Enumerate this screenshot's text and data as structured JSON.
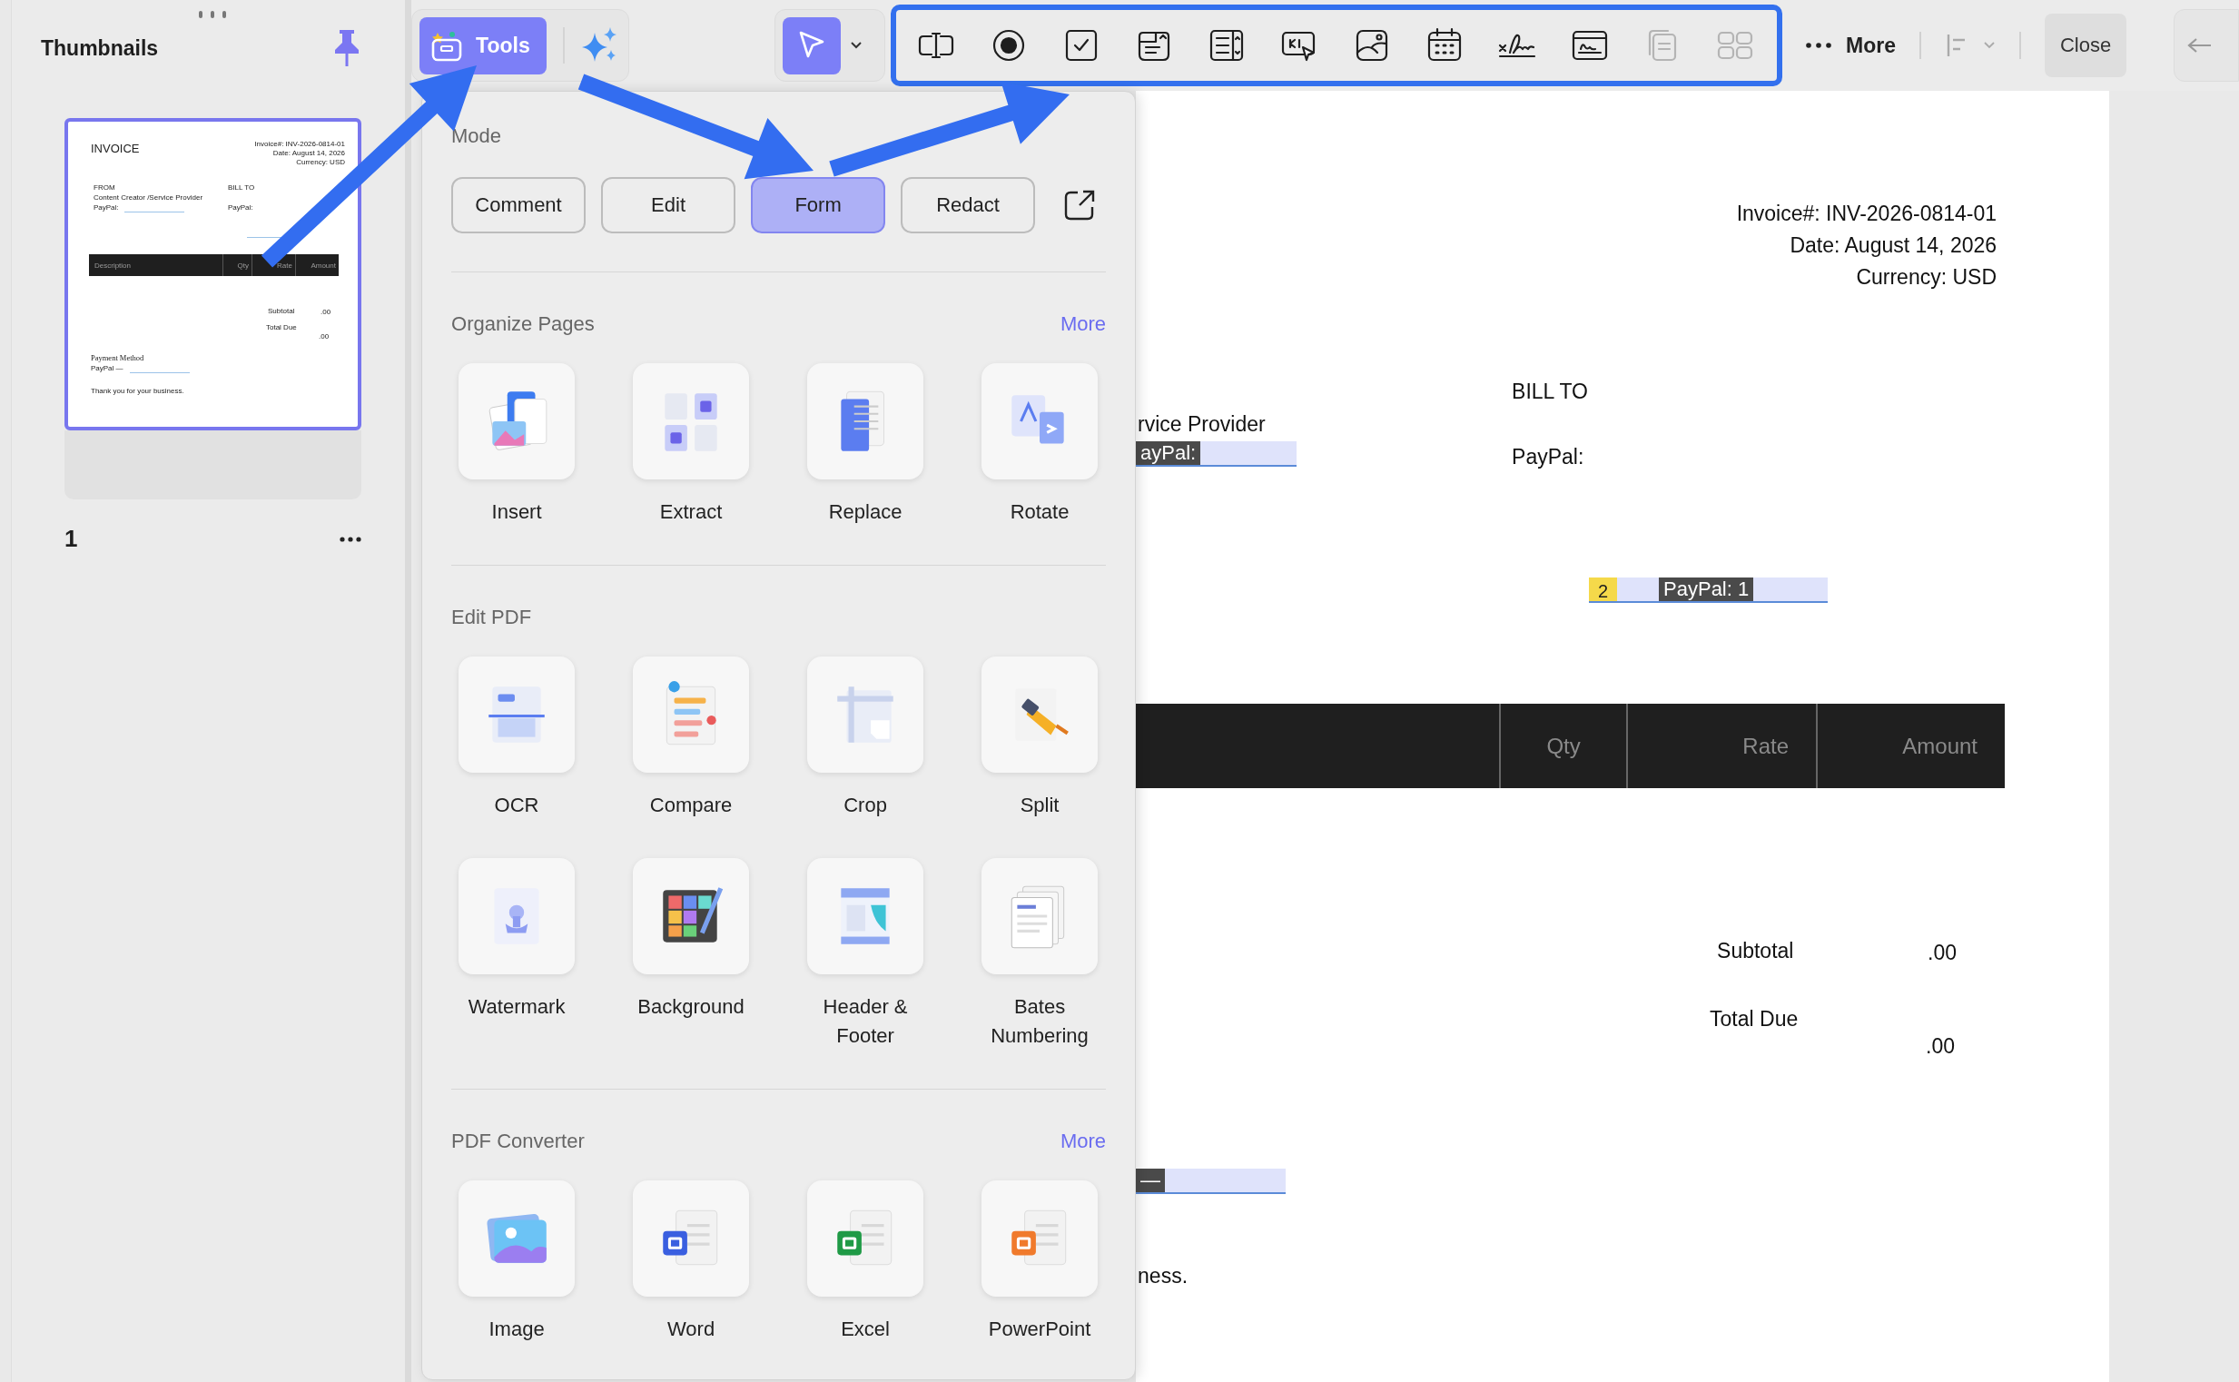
{
  "sidebar": {
    "title": "Thumbnails",
    "pages": [
      {
        "number": "1",
        "selected": true
      }
    ]
  },
  "thumbnail": {
    "title": "INVOICE",
    "meta": [
      "Invoice#: INV-2026-0814-01",
      "Date: August 14, 2026",
      "Currency: USD"
    ],
    "from_label": "FROM",
    "from_name": "Content Creator /Service Provider",
    "from_paypal": "PayPal:",
    "bill_to": "BILL TO",
    "bill_to_paypal": "PayPal:",
    "table_columns": [
      "Description",
      "Qty",
      "Rate",
      "Amount"
    ],
    "subtotal_label": "Subtotal",
    "subtotal_value": ".00",
    "total_label": "Total Due",
    "total_value": ".00",
    "payment_title": "Payment Method",
    "payment_line": "PayPal —",
    "thanks": "Thank you for your business."
  },
  "toolbar": {
    "tools": {
      "label": "Tools",
      "selected": true
    },
    "pointer": {
      "selected": true
    },
    "form_tools": [
      {
        "disabled": false
      },
      {
        "disabled": false
      },
      {
        "disabled": false
      },
      {
        "disabled": false
      },
      {
        "disabled": false
      },
      {
        "disabled": false
      },
      {
        "disabled": false
      },
      {
        "disabled": false
      },
      {
        "disabled": false
      },
      {
        "disabled": false
      },
      {
        "disabled": true
      },
      {
        "disabled": true
      }
    ],
    "more": "More",
    "close": "Close"
  },
  "tools_panel": {
    "mode_title": "Mode",
    "modes": [
      {
        "label": "Comment",
        "selected": false
      },
      {
        "label": "Edit",
        "selected": false
      },
      {
        "label": "Form",
        "selected": true
      },
      {
        "label": "Redact",
        "selected": false
      }
    ],
    "sections": [
      {
        "title": "Organize Pages",
        "more": "More",
        "items": [
          {
            "label": "Insert"
          },
          {
            "label": "Extract"
          },
          {
            "label": "Replace"
          },
          {
            "label": "Rotate"
          }
        ]
      },
      {
        "title": "Edit PDF",
        "items": [
          {
            "label": "OCR"
          },
          {
            "label": "Compare"
          },
          {
            "label": "Crop"
          },
          {
            "label": "Split"
          },
          {
            "label": "Watermark"
          },
          {
            "label": "Background"
          },
          {
            "label": "Header & Footer"
          },
          {
            "label": "Bates Numbering"
          }
        ]
      },
      {
        "title": "PDF Converter",
        "more": "More",
        "items": [
          {
            "label": "Image"
          },
          {
            "label": "Word"
          },
          {
            "label": "Excel"
          },
          {
            "label": "PowerPoint"
          }
        ]
      }
    ]
  },
  "document": {
    "header_lines": [
      "Invoice#: INV-2026-0814-01",
      "Date: August 14, 2026",
      "Currency: USD"
    ],
    "bill_to": "BILL TO",
    "bill_to_paypal": "PayPal:",
    "provider_text": "rvice Provider",
    "fields": [
      {
        "label": "ayPal:"
      },
      {
        "badge": "2",
        "label": "PayPal: 1"
      },
      {
        "label": "—"
      }
    ],
    "table_columns": [
      "Qty",
      "Rate",
      "Amount"
    ],
    "subtotal_label": "Subtotal",
    "subtotal_value": ".00",
    "total_label": "Total Due",
    "total_value": ".00",
    "closing_text": "ness."
  }
}
